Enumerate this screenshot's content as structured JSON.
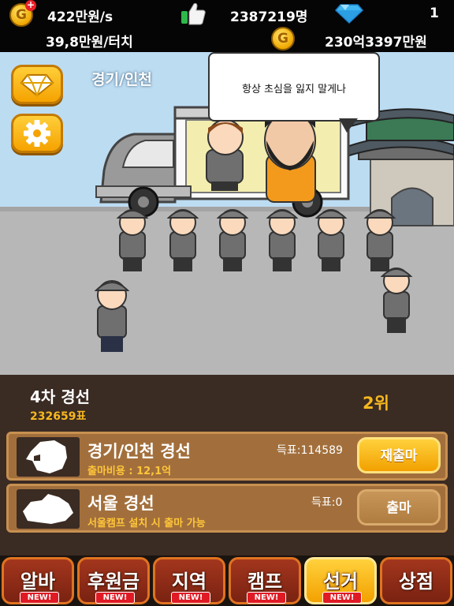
{
  "status": {
    "income_per_sec": "422만원/s",
    "likes": "2387219명",
    "gems": "1",
    "income_per_touch": "39,8만원/터치",
    "money": "230억3397만원"
  },
  "scene": {
    "region_title": "경기/인천",
    "speech_bubble": "항상 초심을 잃지 말게나"
  },
  "election": {
    "round_name": "4차 경선",
    "total_votes": "232659표",
    "rank": "2위",
    "cards": [
      {
        "name": "경기/인천 경선",
        "votes": "득표:114589",
        "sub": "출마비용 : 12,1억",
        "button": "재출마"
      },
      {
        "name": "서울 경선",
        "votes": "득표:0",
        "sub": "서울캠프 설치 시 출마 가능",
        "button": "출마"
      }
    ]
  },
  "tabs": [
    {
      "label": "알바",
      "badge": "NEW!"
    },
    {
      "label": "후원금",
      "badge": "NEW!"
    },
    {
      "label": "지역",
      "badge": "NEW!"
    },
    {
      "label": "캠프",
      "badge": "NEW!"
    },
    {
      "label": "선거",
      "badge": "NEW!"
    },
    {
      "label": "상점",
      "badge": ""
    }
  ],
  "icons": {
    "gold_coin": "gold-coin-icon",
    "thumbs_up": "thumbs-up-icon",
    "diamond": "diamond-icon",
    "settings": "gear-icon"
  },
  "colors": {
    "accent_gold": "#f7b81f",
    "panel_bg": "#3a2b23",
    "card_bg": "#a26f3c",
    "tab_bg": "#8a2a16"
  }
}
